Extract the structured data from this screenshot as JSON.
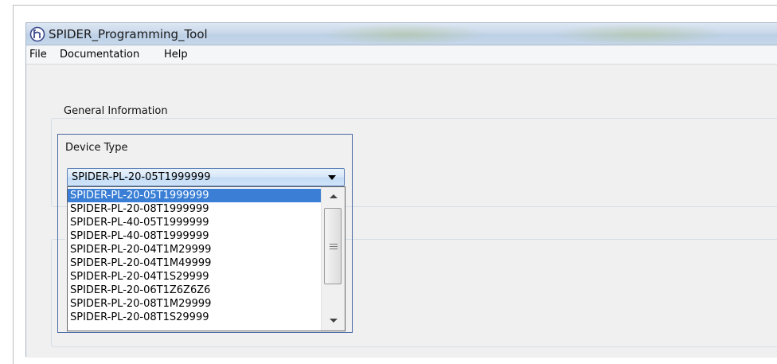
{
  "window": {
    "title": "SPIDER_Programming_Tool",
    "icon": "app-logo-icon"
  },
  "menu": {
    "items": [
      "File",
      "Documentation",
      "Help"
    ]
  },
  "general_group": {
    "title": "General Information"
  },
  "second_group": {
    "title": "("
  },
  "device_type": {
    "label": "Device Type",
    "selected": "SPIDER-PL-20-05T1999999",
    "options": [
      "SPIDER-PL-20-05T1999999",
      "SPIDER-PL-20-08T1999999",
      "SPIDER-PL-40-05T1999999",
      "SPIDER-PL-40-08T1999999",
      "SPIDER-PL-20-04T1M29999",
      "SPIDER-PL-20-04T1M49999",
      "SPIDER-PL-20-04T1S29999",
      "SPIDER-PL-20-06T1Z6Z6Z6",
      "SPIDER-PL-20-08T1M29999",
      "SPIDER-PL-20-08T1S29999"
    ],
    "highlighted_index": 0
  },
  "colors": {
    "selection": "#3a7fd5",
    "panel_border": "#4a68a5"
  }
}
